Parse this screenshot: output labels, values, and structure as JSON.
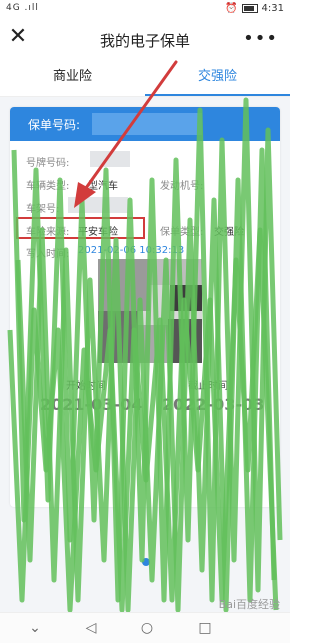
{
  "status": {
    "signal": "4G .ıll",
    "time": "4:31"
  },
  "header": {
    "title": "我的电子保单"
  },
  "tabs": [
    {
      "label": "商业险"
    },
    {
      "label": "交强险"
    }
  ],
  "card": {
    "policy_no_label": "保单号码:",
    "plate_label": "号牌号码:",
    "vehicle_type_label": "车辆类型:",
    "vehicle_type_value": "型汽车",
    "engine_label": "发动机号:",
    "frame_label": "车架号:",
    "source_label": "车险来源:",
    "source_value": "平安车险",
    "insurance_type_label": "保单类型:",
    "insurance_type_value": "交强险",
    "entry_time_label": "写入时间:",
    "entry_time_value": "2021-02-06 10:32:13",
    "start_label": "开始时间",
    "start_value": "2021-03-04",
    "end_label": "截止时间",
    "end_value": "2022-03-03"
  },
  "watermark": "Bai百度经验",
  "colors": {
    "accent": "#2e86de",
    "highlight": "#d23c3c",
    "scribble": "#62c05a"
  }
}
